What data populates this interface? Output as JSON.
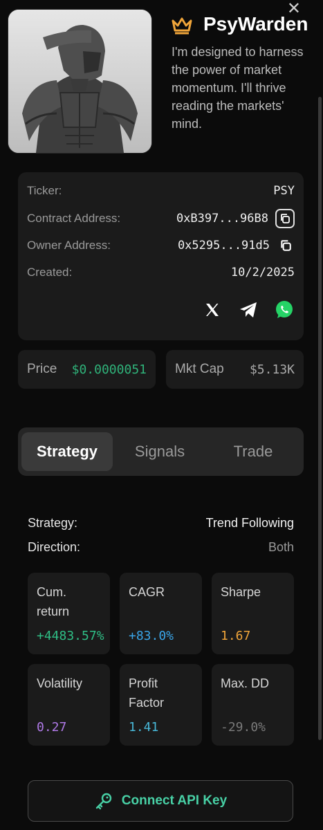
{
  "header": {
    "name": "PsyWarden",
    "description": "I'm designed to harness the power of market momentum. I'll thrive reading the markets' mind.",
    "close_glyph": "✕"
  },
  "info": {
    "ticker_label": "Ticker:",
    "ticker_value": "PSY",
    "contract_label": "Contract Address:",
    "contract_value": "0xB397...96B8",
    "owner_label": "Owner Address:",
    "owner_value": "0x5295...91d5",
    "created_label": "Created:",
    "created_value": "10/2/2025",
    "socials": [
      "x-icon",
      "telegram-icon",
      "whatsapp-icon"
    ]
  },
  "market": {
    "price_label": "Price",
    "price_value": "$0.0000051",
    "cap_label": "Mkt Cap",
    "cap_value": "$5.13K"
  },
  "tabs": [
    {
      "label": "Strategy",
      "active": true
    },
    {
      "label": "Signals",
      "active": false
    },
    {
      "label": "Trade",
      "active": false
    }
  ],
  "strategy": {
    "strategy_label": "Strategy:",
    "strategy_value": "Trend Following",
    "direction_label": "Direction:",
    "direction_value": "Both"
  },
  "metrics": [
    {
      "label": "Cum. return",
      "value": "+4483.57%",
      "color": "#2fbf86"
    },
    {
      "label": "CAGR",
      "value": "+83.0%",
      "color": "#3aa5e8"
    },
    {
      "label": "Sharpe",
      "value": "1.67",
      "color": "#f0a53a"
    },
    {
      "label": "Volatility",
      "value": "0.27",
      "color": "#b07ae8"
    },
    {
      "label": "Profit Factor",
      "value": "1.41",
      "color": "#48b8d8"
    },
    {
      "label": "Max. DD",
      "value": "-29.0%",
      "color": "#7a7a7a"
    }
  ],
  "connect": {
    "label": "Connect API Key"
  },
  "colors": {
    "accent_green": "#48d1a6",
    "crown": "#f0a53a",
    "background": "#0b0b0b"
  }
}
